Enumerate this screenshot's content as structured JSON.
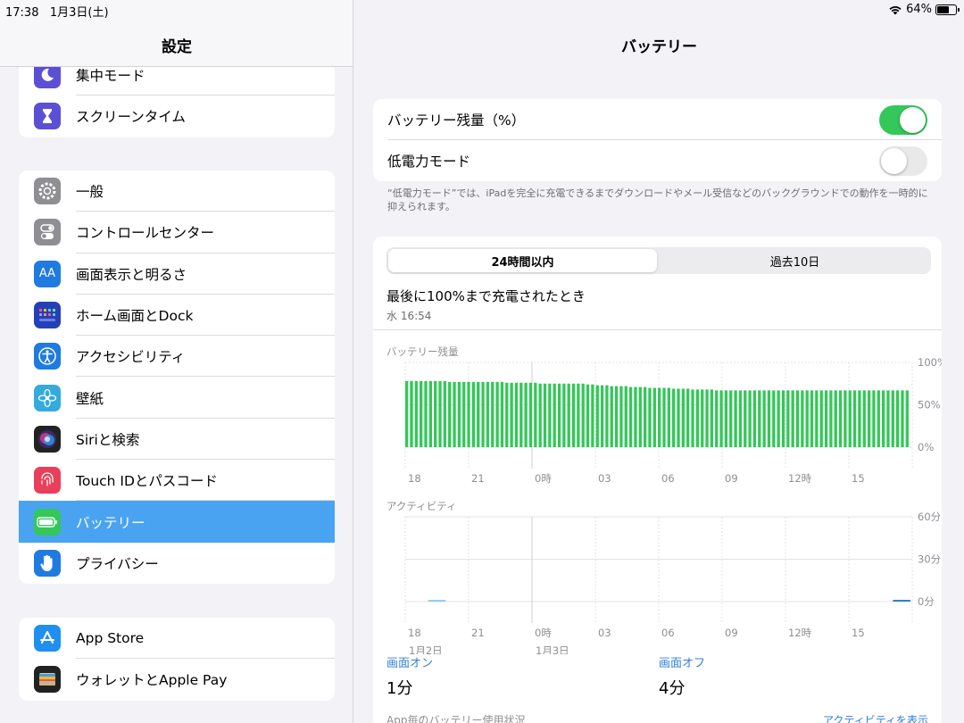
{
  "status_bar": {
    "time": "17:38",
    "date": "1月3日(土)",
    "battery_percent": "64%",
    "battery_level": 0.64
  },
  "sidebar": {
    "title": "設定",
    "groups": [
      {
        "items": [
          {
            "label": "集中モード",
            "icon": "moon-icon",
            "color": "#5b4fd6"
          },
          {
            "label": "スクリーンタイム",
            "icon": "hourglass-icon",
            "color": "#5b4fd6"
          }
        ]
      },
      {
        "items": [
          {
            "label": "一般",
            "icon": "gear-icon",
            "color": "#8e8e93"
          },
          {
            "label": "コントロールセンター",
            "icon": "toggles-icon",
            "color": "#8e8e93"
          },
          {
            "label": "画面表示と明るさ",
            "icon": "text-size-icon",
            "color": "#1f7be0"
          },
          {
            "label": "ホーム画面とDock",
            "icon": "home-grid-icon",
            "color": "#2440b8"
          },
          {
            "label": "アクセシビリティ",
            "icon": "accessibility-icon",
            "color": "#1f7be0"
          },
          {
            "label": "壁紙",
            "icon": "flower-icon",
            "color": "#35aadc"
          },
          {
            "label": "Siriと検索",
            "icon": "siri-icon",
            "color": "#222222"
          },
          {
            "label": "Touch IDとパスコード",
            "icon": "fingerprint-icon",
            "color": "#ea3f5a"
          },
          {
            "label": "バッテリー",
            "icon": "battery-icon",
            "color": "#34c759",
            "selected": true
          },
          {
            "label": "プライバシー",
            "icon": "hand-icon",
            "color": "#1f7be0"
          }
        ]
      },
      {
        "items": [
          {
            "label": "App Store",
            "icon": "app-store-icon",
            "color": "#1f8ff0"
          },
          {
            "label": "ウォレットとApple Pay",
            "icon": "wallet-icon",
            "color": "#222222"
          }
        ]
      }
    ]
  },
  "main": {
    "title": "バッテリー",
    "settings": [
      {
        "label": "バッテリー残量（%）",
        "toggle": true
      },
      {
        "label": "低電力モード",
        "toggle": false
      }
    ],
    "footnote": "“低電力モード”では、iPadを完全に充電できるまでダウンロードやメール受信などのバックグラウンドでの動作を一時的に抑えられます。",
    "tabs": {
      "active": "24時間以内",
      "inactive": "過去10日"
    },
    "last_charged_label": "最後に100%まで充電されたとき",
    "last_charged_time": "水 16:54",
    "screen_on_label": "画面オン",
    "screen_on_value": "1分",
    "screen_off_label": "画面オフ",
    "screen_off_value": "4分",
    "usage_by_app_label": "App毎のバッテリー使用状況",
    "show_activity_label": "アクティビティを表示"
  },
  "chart_data": [
    {
      "type": "bar",
      "title": "バッテリー残量",
      "x_tick_labels": [
        "18",
        "21",
        "0時",
        "03",
        "06",
        "09",
        "12時",
        "15"
      ],
      "y_tick_labels": [
        "100%",
        "50%",
        "0%"
      ],
      "ylim": [
        0,
        100
      ],
      "color": "#34c759",
      "values": [
        78,
        78,
        78,
        78,
        78,
        78,
        78,
        78,
        78,
        77,
        77,
        77,
        77,
        77,
        77,
        77,
        77,
        77,
        77,
        77,
        77,
        76,
        76,
        76,
        76,
        76,
        76,
        76,
        75,
        75,
        75,
        75,
        75,
        75,
        75,
        75,
        75,
        75,
        74,
        74,
        73,
        73,
        73,
        72,
        72,
        72,
        72,
        71,
        71,
        71,
        71,
        70,
        70,
        70,
        70,
        70,
        69,
        69,
        69,
        69,
        68,
        68,
        68,
        68,
        68,
        67,
        67,
        67,
        67,
        67,
        67,
        67,
        67,
        67,
        67,
        67,
        67,
        67,
        67,
        67,
        67,
        67,
        67,
        67,
        67,
        67,
        67,
        67,
        67,
        67,
        67,
        67,
        67,
        67,
        67,
        67,
        67,
        67,
        67,
        67,
        67,
        67,
        67,
        67,
        67,
        67
      ]
    },
    {
      "type": "bar",
      "title": "アクティビティ",
      "x_tick_labels": [
        "18",
        "21",
        "0時",
        "03",
        "06",
        "09",
        "12時",
        "15"
      ],
      "date_labels": [
        "1月2日",
        "1月3日"
      ],
      "y_tick_labels": [
        "60分",
        "30分",
        "0分"
      ],
      "ylim": [
        0,
        60
      ],
      "series": [
        {
          "name": "画面オン",
          "color": "#2f7fd8",
          "points": [
            {
              "hour_index": 23,
              "minutes": 1
            }
          ]
        },
        {
          "name": "画面オフ",
          "color": "#8fd0f5",
          "points": [
            {
              "hour_index": 1,
              "minutes": 1
            }
          ]
        }
      ]
    }
  ]
}
